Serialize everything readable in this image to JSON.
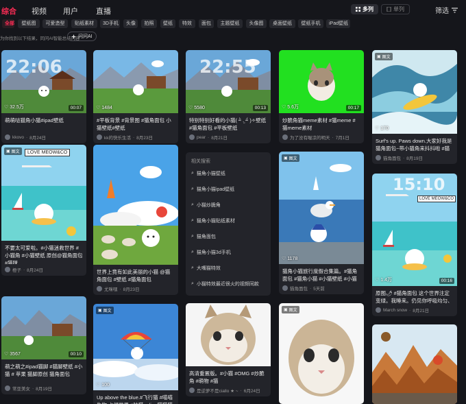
{
  "nav": {
    "tabs": [
      {
        "label": "综合",
        "active": true
      },
      {
        "label": "视频",
        "active": false
      },
      {
        "label": "用户",
        "active": false
      },
      {
        "label": "直播",
        "active": false
      }
    ],
    "layout": {
      "multi": "多列",
      "single": "单列"
    },
    "filter": "筛选"
  },
  "chips": [
    {
      "label": "全部",
      "active": true
    },
    {
      "label": "壁纸图"
    },
    {
      "label": "可爱造型"
    },
    {
      "label": "贴纸素材"
    },
    {
      "label": "3D手机"
    },
    {
      "label": "头像"
    },
    {
      "label": "拍照"
    },
    {
      "label": "壁纸"
    },
    {
      "label": "特效"
    },
    {
      "label": "面包"
    },
    {
      "label": "主题壁纸"
    },
    {
      "label": "头像图"
    },
    {
      "label": "桌面壁纸"
    },
    {
      "label": "壁纸手机"
    },
    {
      "label": "iPad壁纸"
    }
  ],
  "hint": "为你找到以下结果，同问AI智能总结内容",
  "ai_button": "问问AI",
  "badge_label": "图文",
  "cards": [
    {
      "title": "萌萌哒猫角小猫#ipad壁纸",
      "author": "kkovo",
      "date": "8月24日",
      "likes": "32.5万",
      "duration": "00:07"
    },
    {
      "title": "#平板背景 #背景图 #猫角面包 小猫壁纸#壁纸",
      "author": "kk的快乐生活",
      "date": "8月23日",
      "likes": "1484",
      "duration": ""
    },
    {
      "title": "特别特别好看的小猫( ⁼̴̀ .̫ ⁼̴́ )✧壁纸 #猫角面包 #平板壁纸",
      "author": "pear",
      "date": "8月21日",
      "likes": "5580",
      "duration": "00:13"
    },
    {
      "title": "炒脆角猫meme素材 #猫meme #猫meme素材",
      "author": "为了没有喔凉的明天",
      "date": "7月1日",
      "likes": "5.6万",
      "duration": "00:17"
    },
    {
      "title": "Surf's up. Paws down.大家好我是猫角面包~带小猫角来抖抖啦 #猫角小...",
      "author": "猫角面包",
      "date": "8月19日",
      "likes": "170",
      "duration": ""
    },
    {
      "title": "不要太可爱啦。#小猫迷救世界 #小猫角 #小猫壁纸 原创@猫角面包 #猫咪...",
      "author": "橙子",
      "date": "8月24日",
      "likes": "",
      "duration": ""
    },
    {
      "title": "世界上竟有如此美丽的小猫 @猫角面包 #壁纸 #猫角面包",
      "author": "尤咪嘿",
      "date": "8月23日",
      "likes": "",
      "duration": ""
    },
    {
      "title": "猫角小猫旅行度假合集篇。#猫角面包 #猫角小猫 #小猫壁纸 #小猫插画 #插画",
      "author": "猫角面包",
      "date": "5天前",
      "likes": "1178",
      "duration": ""
    },
    {
      "title": "原图🌶 #猫角面包 这个世界注定变绿。我睡来。仍见你呼吸均匀、睫毛...",
      "author": "March snow",
      "date": "8月21日",
      "likes": "1.4万",
      "duration": "00:16"
    },
    {
      "title": "萌之萌之#ipad猫脚 #猫脚壁纸 #小猫 # 苹果 猫脚原创 猫角面包",
      "author": "常亚美女",
      "date": "8月19日",
      "likes": "3567",
      "duration": "00:10"
    },
    {
      "title": "Up above the blue.#飞行猫 #喵喵生物 占领世界 #肿猫online猫猫猫 #飞天...",
      "author": "",
      "date": "",
      "likes": "100",
      "duration": ""
    },
    {
      "title": "高清重置版。#小猫 #OMG #炒脆角 #萌物 #猫",
      "author": "是逆萝不是ciallo ★ ~",
      "date": "6月24日",
      "likes": "",
      "duration": ""
    },
    {
      "title": "",
      "author": "",
      "date": "",
      "likes": "",
      "duration": ""
    },
    {
      "title": "",
      "author": "",
      "date": "",
      "likes": "",
      "duration": ""
    }
  ],
  "related": {
    "heading": "相关搜索",
    "items": [
      "猫角小猫壁纸",
      "猫角小猫ipad壁纸",
      "小猫炒脆角",
      "猫角小猫贴纸素材",
      "猫角面包",
      "猫角小猫3d手机",
      "大嘴猫特效",
      "小猫特效最近很火的视频同款"
    ]
  },
  "overlay_text": {
    "clock1": "22:06",
    "clock2": "22:55",
    "clock3": "15:10",
    "banner": "LOVE MEOW&CO"
  },
  "colors": {
    "accent": "#fe2c55",
    "bg": "#15161b",
    "card": "#23242a"
  }
}
